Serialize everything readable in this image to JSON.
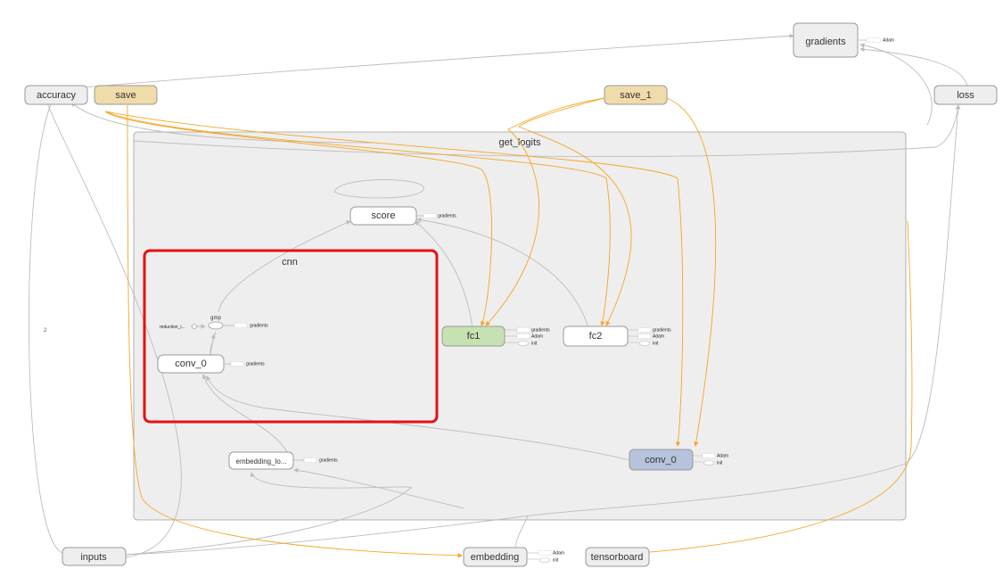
{
  "graph": {
    "nodes": {
      "gradients": "gradients",
      "accuracy": "accuracy",
      "save": "save",
      "save_1": "save_1",
      "loss": "loss",
      "score": "score",
      "fc1": "fc1",
      "fc2": "fc2",
      "conv_0_inner": "conv_0",
      "conv_0_outer": "conv_0",
      "embedding_lookup": "embedding_lo...",
      "gmp": "gmp",
      "reduction": "reduction_i...",
      "inputs": "inputs",
      "embedding": "embedding",
      "tensorboard": "tensorboard"
    },
    "groups": {
      "get_logits": "get_logits",
      "cnn": "cnn"
    },
    "aux": {
      "gradients": "gradients",
      "adam": "Adam",
      "init": "init"
    },
    "edge_label_2": "2",
    "colors": {
      "node_fill": "#eeeeee",
      "save_fill": "#f0dcaa",
      "fc1_fill": "#c6e2b2",
      "conv_outer_fill": "#b7c3dc",
      "group_fill": "#eeeeee",
      "highlight": "#e81010",
      "edge_grey": "#bdbdbd",
      "edge_orange": "#f5a623"
    }
  }
}
